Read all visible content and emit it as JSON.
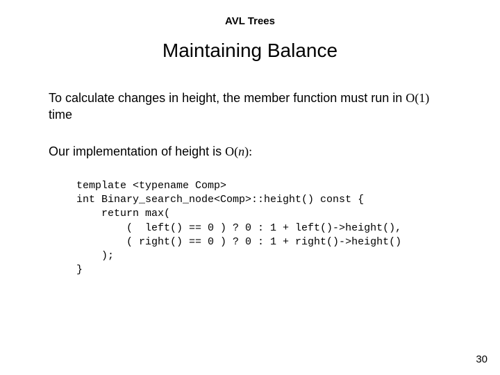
{
  "header": "AVL Trees",
  "title": "Maintaining Balance",
  "para1_a": "To calculate changes in height, the member function must run in ",
  "para1_b": "O(1)",
  "para1_c": " time",
  "para2_a": "Our implementation of height is ",
  "para2_b": "O(",
  "para2_c": "n",
  "para2_d": "):",
  "code_l1": "template <typename Comp>",
  "code_l2": "int Binary_search_node<Comp>::height() const {",
  "code_l3": "    return max(",
  "code_l4": "        (  left() == 0 ) ? 0 : 1 + left()->height(),",
  "code_l5": "        ( right() == 0 ) ? 0 : 1 + right()->height()",
  "code_l6": "    );",
  "code_l7": "}",
  "page_num": "30"
}
